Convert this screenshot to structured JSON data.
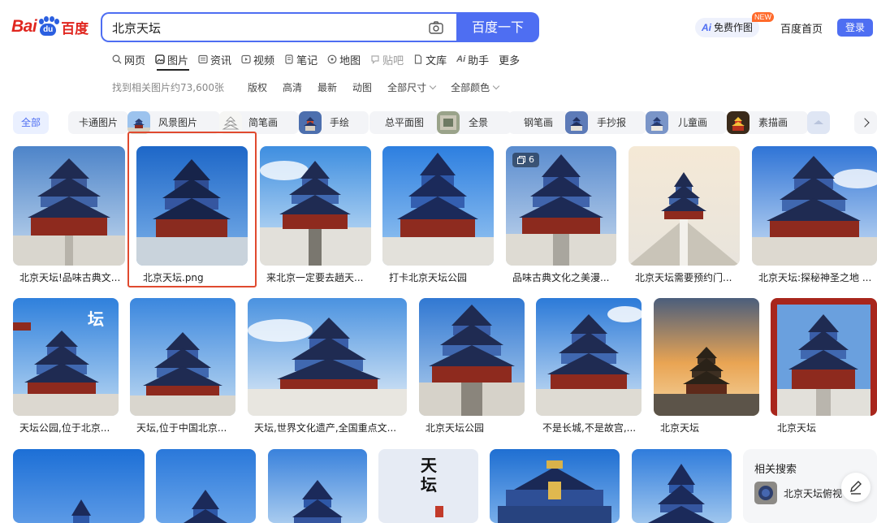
{
  "logo": {
    "bai": "Bai",
    "du_pad": "du",
    "du": "百度"
  },
  "search": {
    "query": "北京天坛",
    "button": "百度一下"
  },
  "header": {
    "ai_badge": "Ai",
    "ai_free": "免费作图",
    "new_badge": "NEW",
    "home": "百度首页",
    "login": "登录"
  },
  "tabs": [
    {
      "label": "网页",
      "icon": "search-icon"
    },
    {
      "label": "图片",
      "icon": "image-icon",
      "active": true
    },
    {
      "label": "资讯",
      "icon": "news-icon"
    },
    {
      "label": "视频",
      "icon": "video-icon"
    },
    {
      "label": "笔记",
      "icon": "note-icon"
    },
    {
      "label": "地图",
      "icon": "map-icon"
    },
    {
      "label": "贴吧",
      "icon": "tieba-icon"
    },
    {
      "label": "文库",
      "icon": "doc-icon"
    },
    {
      "label": "助手",
      "icon": "ai-assistant-icon",
      "prefix": "Ai"
    },
    {
      "label": "更多"
    }
  ],
  "filters": {
    "result_count": "找到相关图片约73,600张",
    "items": [
      "版权",
      "高清",
      "最新",
      "动图",
      "全部尺寸",
      "全部颜色"
    ]
  },
  "chips": [
    {
      "label": "全部",
      "active": true
    },
    {
      "label": "卡通图片"
    },
    {
      "label": "风景图片",
      "thumb": true
    },
    {
      "label": "简笔画",
      "thumb": true
    },
    {
      "label": "手绘",
      "thumb": true
    },
    {
      "label": "总平面图"
    },
    {
      "label": "全景",
      "thumb": true
    },
    {
      "label": "钢笔画"
    },
    {
      "label": "手抄报",
      "thumb": true
    },
    {
      "label": "儿童画",
      "thumb": true
    },
    {
      "label": "素描画",
      "thumb": true
    }
  ],
  "rows": [
    [
      {
        "caption": "北京天坛!品味古典文..."
      },
      {
        "caption": "北京天坛.png",
        "selected": true
      },
      {
        "caption": "来北京一定要去趟天..."
      },
      {
        "caption": "打卡北京天坛公园"
      },
      {
        "caption": "品味古典文化之美漫...",
        "badge": "6"
      },
      {
        "caption": "北京天坛需要预约门..."
      },
      {
        "caption": "北京天坛:探秘神圣之地 ..."
      }
    ],
    [
      {
        "caption": "天坛公园,位于北京...",
        "overlay": "坛"
      },
      {
        "caption": "天坛,位于中国北京..."
      },
      {
        "caption": "天坛,世界文化遗产,全国重点文..."
      },
      {
        "caption": "北京天坛公园"
      },
      {
        "caption": "不是长城,不是故宫,..."
      },
      {
        "caption": "北京天坛"
      },
      {
        "caption": "北京天坛"
      }
    ]
  ],
  "row3_overlay": [
    "天",
    "坛"
  ],
  "related": {
    "title": "相关搜索",
    "item": "北京天坛俯视"
  },
  "colors": {
    "accent": "#4e6ef2",
    "brand_red": "#e0261f",
    "selected_frame": "#e04a2f"
  }
}
